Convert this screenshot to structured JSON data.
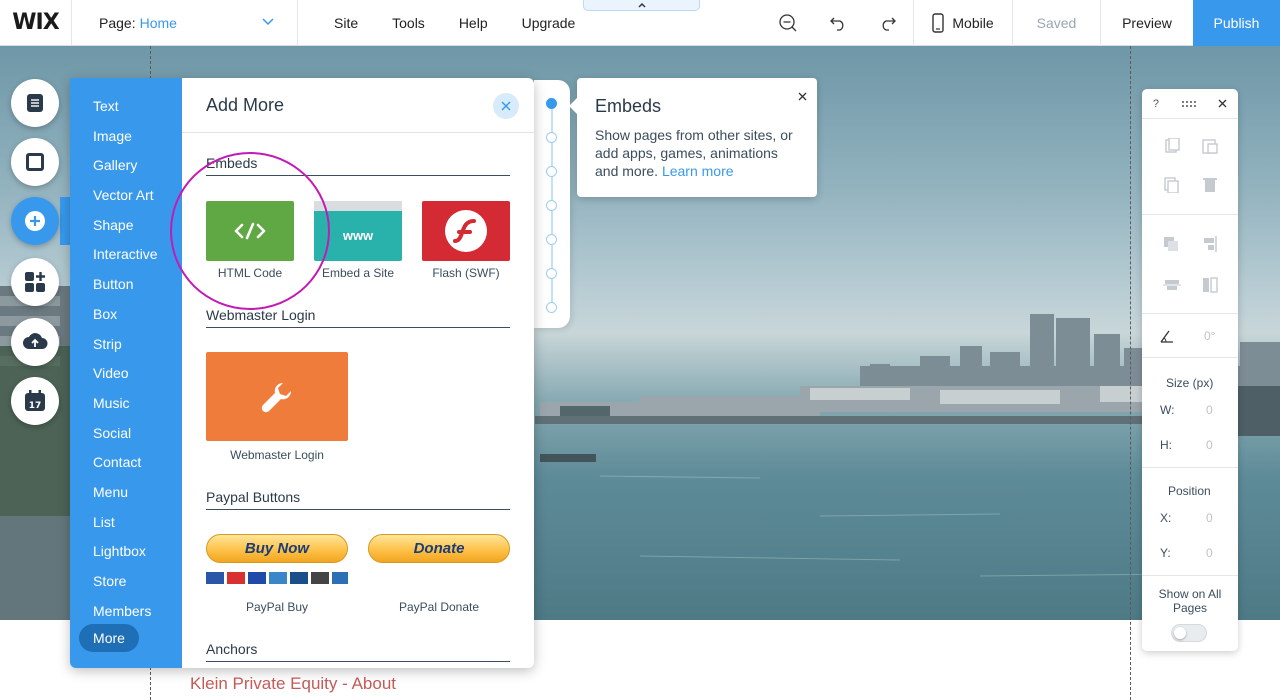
{
  "topbar": {
    "logo": "WIX",
    "page_label": "Page:",
    "page_name": "Home",
    "menus": [
      "Site",
      "Tools",
      "Help",
      "Upgrade"
    ],
    "mobile_label": "Mobile",
    "saved_label": "Saved",
    "preview_label": "Preview",
    "publish_label": "Publish"
  },
  "add_panel": {
    "categories": [
      "Text",
      "Image",
      "Gallery",
      "Vector Art",
      "Shape",
      "Interactive",
      "Button",
      "Box",
      "Strip",
      "Video",
      "Music",
      "Social",
      "Contact",
      "Menu",
      "List",
      "Lightbox",
      "Store",
      "Members"
    ],
    "selected_category": "More",
    "title": "Add More",
    "sections": {
      "embeds": "Embeds",
      "webmaster": "Webmaster Login",
      "paypal": "Paypal Buttons",
      "anchors": "Anchors"
    },
    "items": {
      "html_code": "HTML Code",
      "embed_site": "Embed a Site",
      "embed_site_tile": "www",
      "flash": "Flash (SWF)",
      "webmaster_login": "Webmaster Login",
      "buy_now_button": "Buy Now",
      "donate_button": "Donate",
      "paypal_buy": "PayPal Buy",
      "paypal_donate": "PayPal Donate"
    }
  },
  "tooltip": {
    "title": "Embeds",
    "body": "Show pages from other sites, or add apps, games, animations and more.",
    "link": "Learn more"
  },
  "props": {
    "help": "?",
    "rotation": "0°",
    "size_title": "Size (px)",
    "w_label": "W:",
    "w_value": "0",
    "h_label": "H:",
    "h_value": "0",
    "position_title": "Position",
    "x_label": "X:",
    "x_value": "0",
    "y_label": "Y:",
    "y_value": "0",
    "show_all": "Show on All Pages"
  },
  "canvas": {
    "footer_text": "Klein Private Equity - About"
  },
  "colors": {
    "accent": "#3899ec",
    "highlight": "#c21bb5",
    "footer_text": "#c45b58"
  }
}
